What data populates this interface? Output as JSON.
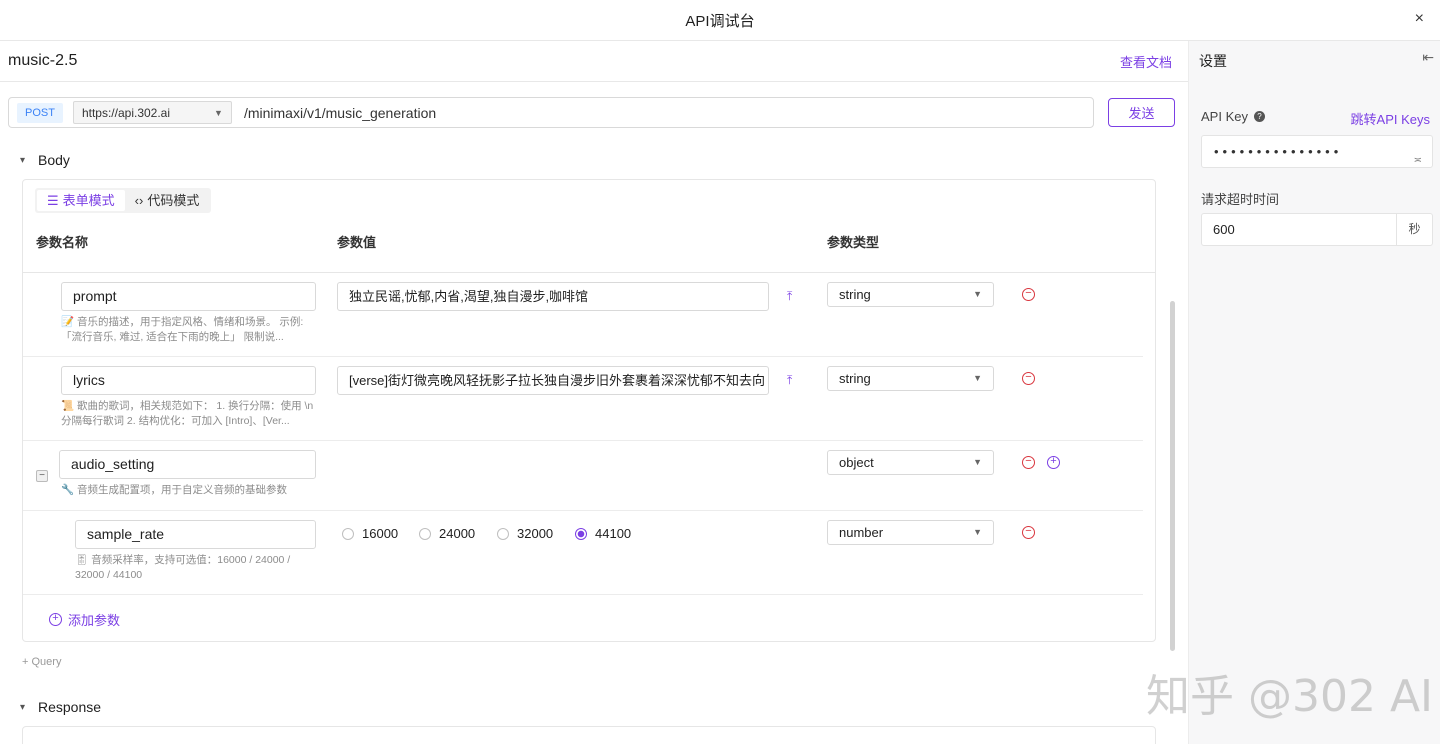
{
  "window": {
    "title": "API调试台",
    "close_icon": "×"
  },
  "main": {
    "model_name": "music-2.5",
    "doc_link": "查看文档",
    "method": "POST",
    "host": "https://api.302.ai",
    "path": "/minimaxi/v1/music_generation",
    "send_label": "发送",
    "body_section": "Body",
    "mode_tabs": [
      {
        "label": "表单模式",
        "active": true
      },
      {
        "label": "代码模式",
        "active": false
      }
    ],
    "columns": {
      "name": "参数名称",
      "value": "参数值",
      "type": "参数类型"
    },
    "params": [
      {
        "name": "prompt",
        "desc": "📝 音乐的描述，用于指定风格、情绪和场景。 示例:「流行音乐, 难过, 适合在下雨的晚上」 限制说...",
        "value": "独立民谣,忧郁,内省,渴望,独自漫步,咖啡馆",
        "type": "string"
      },
      {
        "name": "lyrics",
        "desc": "📜 歌曲的歌词，相关规范如下： 1. 换行分隔：使用 \\n 分隔每行歌词 2. 结构优化：可加入 [Intro]、[Ver...",
        "value": "[verse]街灯微亮晚风轻抚影子拉长独自漫步旧外套裹着深深忧郁不知去向",
        "type": "string"
      },
      {
        "name": "audio_setting",
        "desc": "🔧 音频生成配置项，用于自定义音频的基础参数",
        "type": "object",
        "collapse": "−"
      },
      {
        "name": "sample_rate",
        "desc": "🎚 音频采样率，支持可选值：16000 / 24000 / 32000 / 44100",
        "type": "number",
        "options": [
          "16000",
          "24000",
          "32000",
          "44100"
        ],
        "selected": "44100"
      }
    ],
    "add_param": "添加参数",
    "query_label": "Query",
    "response_section": "Response"
  },
  "settings": {
    "title": "设置",
    "api_key_label": "API Key",
    "api_key_link": "跳转API Keys",
    "api_key_masked": "•••••••••••••••",
    "timeout_label": "请求超时时间",
    "timeout_value": "600",
    "timeout_unit": "秒"
  },
  "watermark": "知乎 @302 AI",
  "colors": {
    "accent": "#7b3fe4",
    "danger": "#d9363e",
    "method_bg": "#e8f3ff"
  }
}
